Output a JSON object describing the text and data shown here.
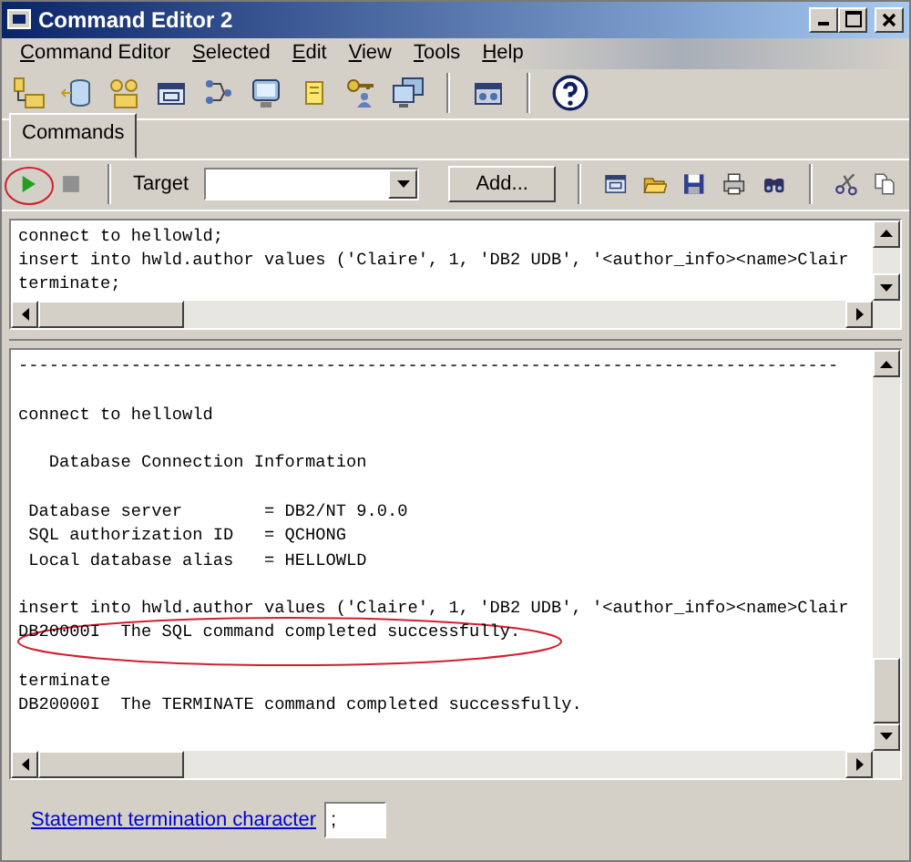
{
  "window": {
    "title": "Command Editor 2"
  },
  "menu": [
    "Command Editor",
    "Selected",
    "Edit",
    "View",
    "Tools",
    "Help"
  ],
  "tabs": [
    {
      "label": "Commands",
      "selected": true
    }
  ],
  "command_toolbar": {
    "target_label": "Target",
    "add_button": "Add..."
  },
  "editor": {
    "lines": [
      "connect to hellowld;",
      "insert into hwld.author values ('Claire', 1, 'DB2 UDB', '<author_info><name>Clair",
      "terminate;"
    ]
  },
  "output": {
    "blocks": [
      {
        "lines": [
          "--------------------------------------------------------------------------------"
        ]
      },
      {
        "lines": [
          "connect to hellowld"
        ]
      },
      {
        "lines": [
          "   Database Connection Information"
        ]
      },
      {
        "lines": [
          " Database server        = DB2/NT 9.0.0",
          " SQL authorization ID   = QCHONG",
          " Local database alias   = HELLOWLD"
        ]
      },
      {
        "lines": [
          "insert into hwld.author values ('Claire', 1, 'DB2 UDB', '<author_info><name>Clair",
          "DB20000I  The SQL command completed successfully."
        ]
      },
      {
        "lines": [
          "terminate",
          "DB20000I  The TERMINATE command completed successfully."
        ]
      }
    ]
  },
  "footer": {
    "link": "Statement termination character",
    "value": ";"
  }
}
